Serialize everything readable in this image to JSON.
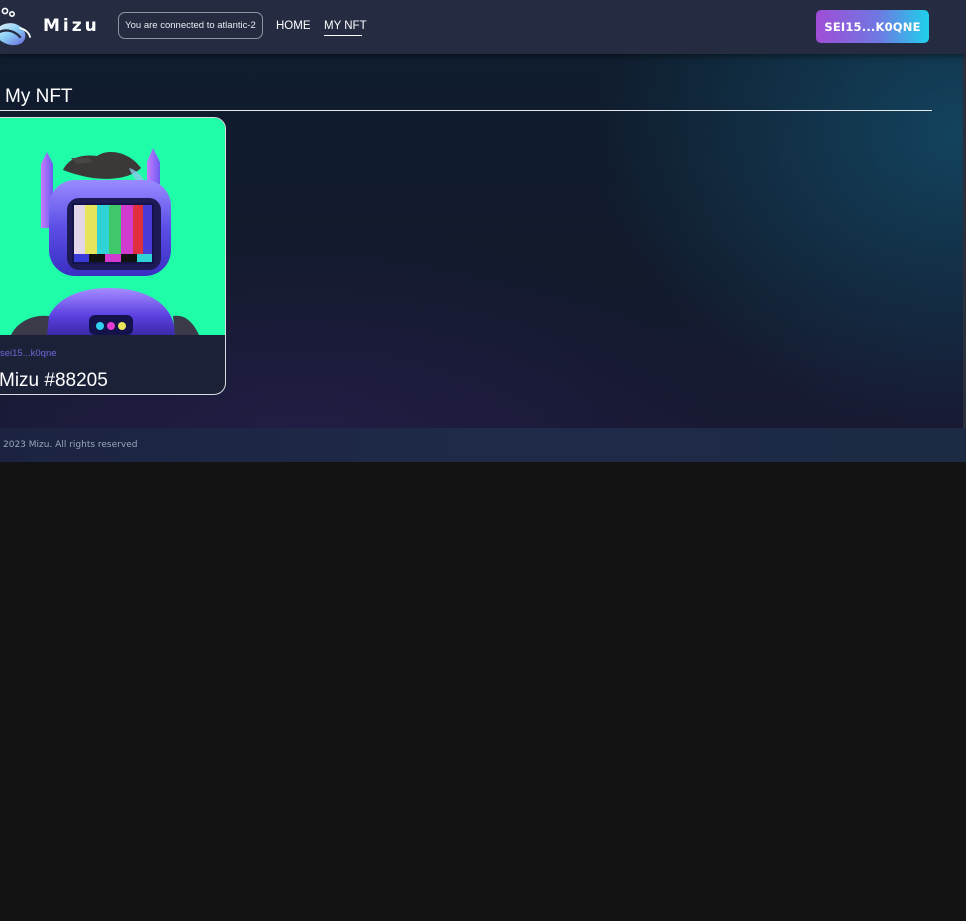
{
  "header": {
    "brand": "Mizu",
    "network_status": "You are connected to atlantic-2",
    "nav": {
      "home": "HOME",
      "my_nft": "MY NFT",
      "active": "MY NFT"
    },
    "wallet_button": "SEI15...K0QNE"
  },
  "main": {
    "title": "My NFT",
    "nfts": [
      {
        "owner": "sei15...k0qne",
        "name": "Mizu #88205",
        "image_background": "#1ffda9"
      }
    ]
  },
  "footer": {
    "copyright": "2023 Mizu. All rights reserved"
  },
  "colors": {
    "header_bg": "#252c42",
    "page_bg": "#131313",
    "accent_gradient_start": "#a04dd6",
    "accent_gradient_end": "#1fd1ec",
    "owner_text": "#6b67d9"
  }
}
